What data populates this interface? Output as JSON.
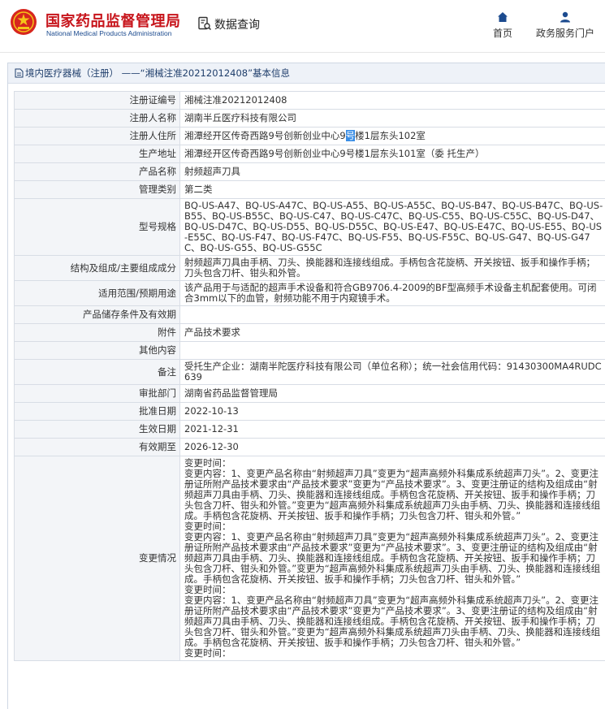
{
  "header": {
    "brand_cn": "国家药品监督管理局",
    "brand_en": "National Medical Products Administration",
    "query_label": "数据查询",
    "nav": [
      {
        "label": "首页",
        "icon": "home-icon"
      },
      {
        "label": "政务服务门户",
        "icon": "user-icon"
      }
    ],
    "brand_color": "#c7141b",
    "accent_color": "#1c4b8f"
  },
  "panel": {
    "title": "境内医疗器械（注册） ——“湘械注准20212012408”基本信息"
  },
  "fields": {
    "reg_no": {
      "label": "注册证编号",
      "value": "湘械注准20212012408"
    },
    "registrant": {
      "label": "注册人名称",
      "value": "湖南半丘医疗科技有限公司"
    },
    "registrant_addr": {
      "label": "注册人住所",
      "value_a": "湘潭经开区传奇西路9号创新创业中心9",
      "value_mark": "号",
      "value_b": "楼1层东头102室"
    },
    "prod_addr": {
      "label": "生产地址",
      "value": "湘潭经开区传奇西路9号创新创业中心9号楼1层东头101室（委 托生产）"
    },
    "product_name": {
      "label": "产品名称",
      "value": "射频超声刀具"
    },
    "mgmt_class": {
      "label": "管理类别",
      "value": "第二类"
    },
    "models": {
      "label": "型号规格",
      "value": "BQ-US-A47、BQ-US-A47C、BQ-US-A55、BQ-US-A55C、BQ-US-B47、BQ-US-B47C、BQ-US-B55、BQ-US-B55C、BQ-US-C47、BQ-US-C47C、BQ-US-C55、BQ-US-C55C、BQ-US-D47、BQ-US-D47C、BQ-US-D55、BQ-US-D55C、BQ-US-E47、BQ-US-E47C、BQ-US-E55、BQ-US-E55C、BQ-US-F47、BQ-US-F47C、BQ-US-F55、BQ-US-F55C、BQ-US-G47、BQ-US-G47C、BQ-US-G55、BQ-US-G55C"
    },
    "structure": {
      "label": "结构及组成/主要组成成分",
      "value": "射频超声刀具由手柄、刀头、换能器和连接线组成。手柄包含花旋柄、开关按钮、扳手和操作手柄；刀头包含刀杆、钳头和外管。"
    },
    "scope": {
      "label": "适用范围/预期用途",
      "value": "该产品用于与适配的超声手术设备和符合GB9706.4-2009的BF型高频手术设备主机配套使用。可闭合3mm以下的血管，射频功能不用于内窥镜手术。"
    },
    "storage": {
      "label": "产品储存条件及有效期",
      "value": ""
    },
    "attachment": {
      "label": "附件",
      "value": "产品技术要求"
    },
    "other": {
      "label": "其他内容",
      "value": ""
    },
    "remarks": {
      "label": "备注",
      "value": "受托生产企业：湖南半陀医疗科技有限公司（单位名称）；统一社会信用代码：91430300MA4RUDC639"
    },
    "approval_dept": {
      "label": "审批部门",
      "value": "湖南省药品监督管理局"
    },
    "approval_date": {
      "label": "批准日期",
      "value": "2022-10-13"
    },
    "effective_date": {
      "label": "生效日期",
      "value": "2021-12-31"
    },
    "expiry_date": {
      "label": "有效期至",
      "value": "2026-12-30"
    },
    "changes": {
      "label": "变更情况",
      "value": "变更时间：\n变更内容：1、变更产品名称由“射频超声刀具”变更为“超声高频外科集成系统超声刀头”。2、变更注册证所附产品技术要求由“产品技术要求”变更为“产品技术要求”。3、变更注册证的结构及组成由“射频超声刀具由手柄、刀头、换能器和连接线组成。手柄包含花旋柄、开关按钮、扳手和操作手柄；刀头包含刀杆、钳头和外管。”变更为“超声高频外科集成系统超声刀头由手柄、刀头、换能器和连接线组成。手柄包含花旋柄、开关按钮、扳手和操作手柄；刀头包含刀杆、钳头和外管。”\n变更时间：\n变更内容：1、变更产品名称由“射频超声刀具”变更为“超声高频外科集成系统超声刀头”。2、变更注册证所附产品技术要求由“产品技术要求”变更为“产品技术要求”。3、变更注册证的结构及组成由“射频超声刀具由手柄、刀头、换能器和连接线组成。手柄包含花旋柄、开关按钮、扳手和操作手柄；刀头包含刀杆、钳头和外管。”变更为“超声高频外科集成系统超声刀头由手柄、刀头、换能器和连接线组成。手柄包含花旋柄、开关按钮、扳手和操作手柄；刀头包含刀杆、钳头和外管。”\n变更时间：\n变更内容：1、变更产品名称由“射频超声刀具”变更为“超声高频外科集成系统超声刀头”。2、变更注册证所附产品技术要求由“产品技术要求”变更为“产品技术要求”。3、变更注册证的结构及组成由“射频超声刀具由手柄、刀头、换能器和连接线组成。手柄包含花旋柄、开关按钮、扳手和操作手柄；刀头包含刀杆、钳头和外管。”变更为“超声高频外科集成系统超声刀头由手柄、刀头、换能器和连接线组成。手柄包含花旋柄、开关按钮、扳手和操作手柄；刀头包含刀杆、钳头和外管。”\n变更时间："
    }
  }
}
